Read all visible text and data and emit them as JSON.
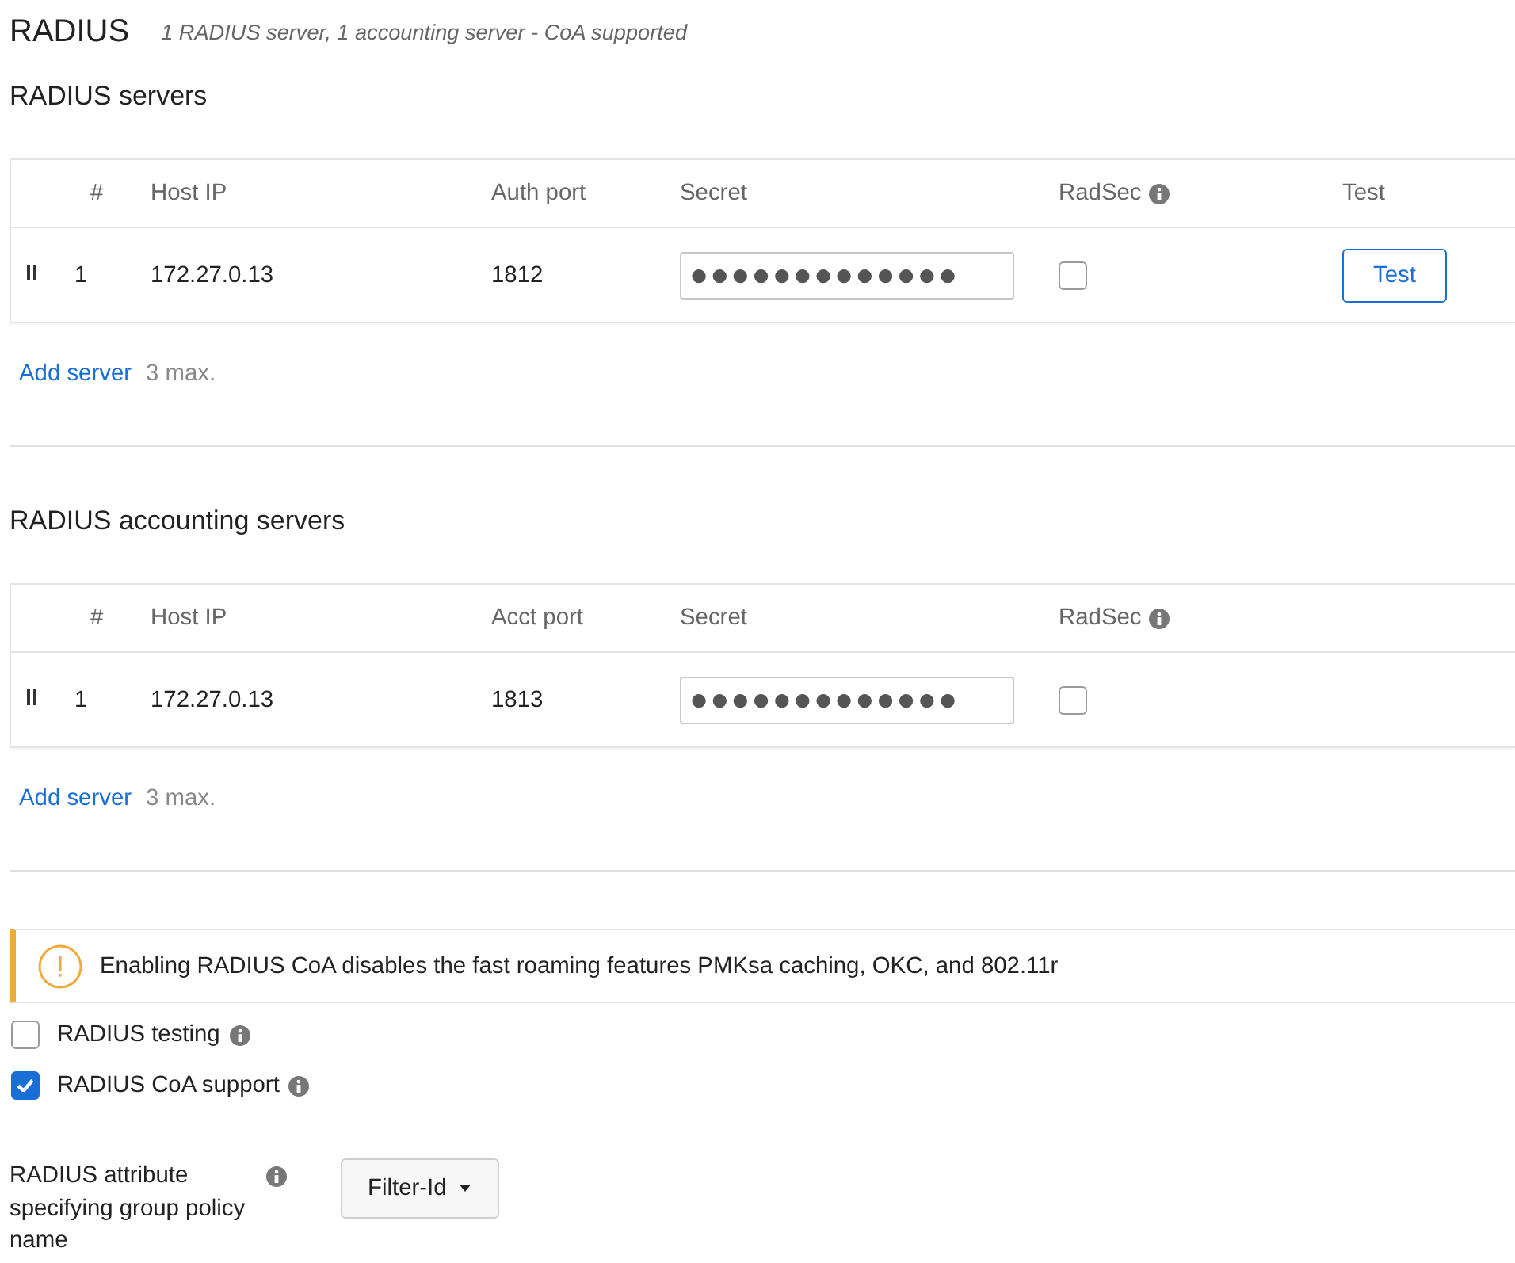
{
  "header": {
    "title": "RADIUS",
    "summary": "1 RADIUS server, 1 accounting server - CoA supported"
  },
  "server_sections": [
    {
      "title": "RADIUS servers",
      "columns": [
        {
          "label": "#",
          "info": false
        },
        {
          "label": "Host IP",
          "info": false
        },
        {
          "label": "Auth port",
          "info": false
        },
        {
          "label": "Secret",
          "info": false
        },
        {
          "label": "RadSec",
          "info": true
        },
        {
          "label": "Test",
          "info": false
        }
      ],
      "rows": [
        {
          "index": "1",
          "host_ip": "172.27.0.13",
          "port": "1812",
          "secret": "●●●●●●●●●●●●●",
          "radsec_checked": false,
          "test_button": "Test"
        }
      ],
      "add_link": "Add server",
      "limit": "3 max."
    },
    {
      "title": "RADIUS accounting servers",
      "columns": [
        {
          "label": "#",
          "info": false
        },
        {
          "label": "Host IP",
          "info": false
        },
        {
          "label": "Acct port",
          "info": false
        },
        {
          "label": "Secret",
          "info": false
        },
        {
          "label": "RadSec",
          "info": true
        }
      ],
      "rows": [
        {
          "index": "1",
          "host_ip": "172.27.0.13",
          "port": "1813",
          "secret": "●●●●●●●●●●●●●",
          "radsec_checked": false
        }
      ],
      "add_link": "Add server",
      "limit": "3 max."
    }
  ],
  "warning": {
    "text": "Enabling RADIUS CoA disables the fast roaming features PMKsa caching, OKC, and 802.11r"
  },
  "options": [
    {
      "label": "RADIUS testing",
      "checked": false,
      "info": true
    },
    {
      "label": "RADIUS CoA support",
      "checked": true,
      "info": true
    }
  ],
  "attribute": {
    "label": "RADIUS attribute specifying group policy name",
    "info": true,
    "value": "Filter-Id"
  }
}
